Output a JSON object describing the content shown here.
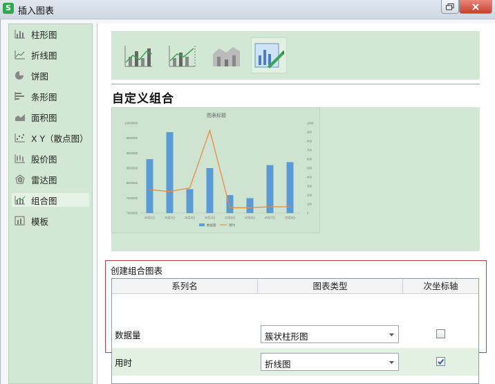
{
  "window": {
    "title": "插入图表",
    "app_icon_letter": "S"
  },
  "sidebar": {
    "items": [
      {
        "label": "柱形图",
        "icon": "column-chart-icon",
        "selected": false
      },
      {
        "label": "折线图",
        "icon": "line-chart-icon",
        "selected": false
      },
      {
        "label": "饼图",
        "icon": "pie-chart-icon",
        "selected": false
      },
      {
        "label": "条形图",
        "icon": "bar-chart-icon",
        "selected": false
      },
      {
        "label": "面积图",
        "icon": "area-chart-icon",
        "selected": false
      },
      {
        "label": "X Y（散点图）",
        "icon": "scatter-chart-icon",
        "selected": false
      },
      {
        "label": "股价图",
        "icon": "stock-chart-icon",
        "selected": false
      },
      {
        "label": "雷达图",
        "icon": "radar-chart-icon",
        "selected": false
      },
      {
        "label": "组合图",
        "icon": "combo-chart-icon",
        "selected": true
      },
      {
        "label": "模板",
        "icon": "template-icon",
        "selected": false
      }
    ]
  },
  "main": {
    "section_title": "自定义组合",
    "subtypes": [
      {
        "icon": "clustered-column-line-icon",
        "selected": false
      },
      {
        "icon": "column-line-secondary-axis-icon",
        "selected": false
      },
      {
        "icon": "stacked-area-column-icon",
        "selected": false
      },
      {
        "icon": "custom-combo-icon",
        "selected": true
      }
    ]
  },
  "chart_data": {
    "type": "bar",
    "title": "图表标题",
    "categories": [
      "10月1日",
      "10月2日",
      "10月3日",
      "10月4日",
      "10月5日",
      "10月6日",
      "10月7日",
      "10月8日"
    ],
    "series": [
      {
        "name": "数据量",
        "chart": "bar",
        "axis": "primary",
        "color": "#5b9bd5",
        "values": [
          8800000,
          9700000,
          7800000,
          8500000,
          7600000,
          7500000,
          8600000,
          8700000
        ]
      },
      {
        "name": "用时",
        "chart": "line",
        "axis": "secondary",
        "color": "#ed8a3a",
        "values": [
          260,
          240,
          280,
          920,
          60,
          60,
          70,
          70
        ]
      }
    ],
    "ylim": [
      7000000,
      10000000
    ],
    "y_ticks": [
      "7000000",
      "7500000",
      "8000000",
      "8500000",
      "9000000",
      "9500000",
      "10000000"
    ],
    "y2lim": [
      0,
      1000
    ],
    "y2_ticks": [
      "0",
      "100",
      "200",
      "300",
      "400",
      "500",
      "600",
      "700",
      "800",
      "900",
      "1000"
    ],
    "legend": "bottom",
    "grid": false
  },
  "combo": {
    "label": "创建组合图表",
    "headers": {
      "series": "系列名",
      "type": "图表类型",
      "secondary": "次坐标轴"
    },
    "rows": [
      {
        "name": "数据量",
        "type": "簇状柱形图",
        "secondary": false
      },
      {
        "name": "用时",
        "type": "折线图",
        "secondary": true
      }
    ]
  },
  "colors": {
    "panel_green": "#d2e8d4",
    "accent_green": "#3aa655",
    "highlight_red": "#cf3a3a",
    "bar_blue": "#5b9bd5",
    "line_orange": "#ed8a3a"
  }
}
